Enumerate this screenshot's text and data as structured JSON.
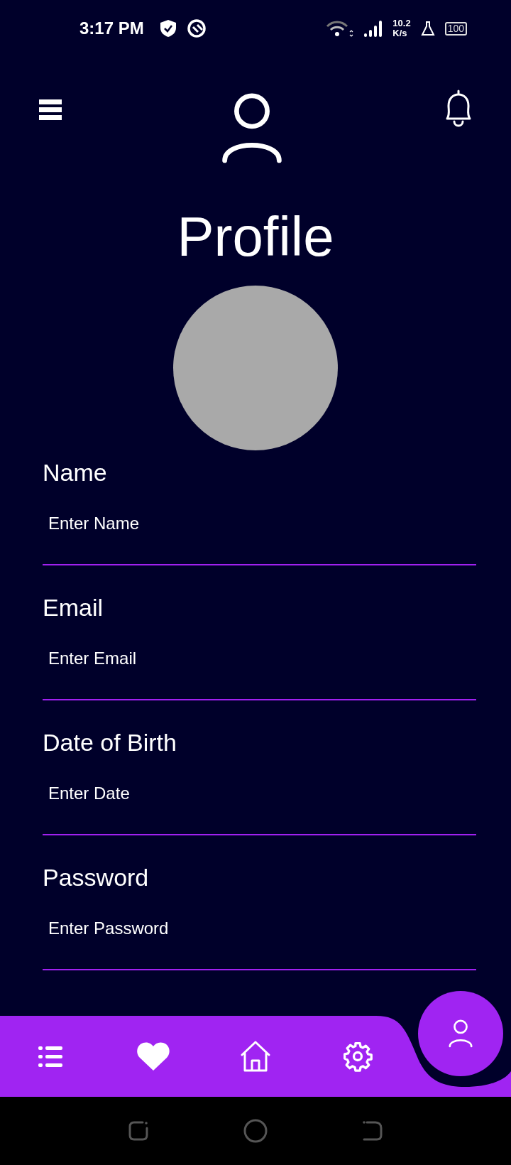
{
  "status_bar": {
    "time": "3:17 PM",
    "speed_value": "10.2",
    "speed_unit": "K/s",
    "battery": "100"
  },
  "title": "Profile",
  "fields": [
    {
      "label": "Name",
      "placeholder": "Enter Name"
    },
    {
      "label": "Email",
      "placeholder": "Enter Email"
    },
    {
      "label": "Date of Birth",
      "placeholder": "Enter Date"
    },
    {
      "label": "Password",
      "placeholder": "Enter Password"
    }
  ],
  "bottom_nav": {
    "items": [
      {
        "selected": false
      },
      {
        "selected": false
      },
      {
        "selected": false
      },
      {
        "selected": false
      },
      {
        "selected": true
      }
    ]
  }
}
